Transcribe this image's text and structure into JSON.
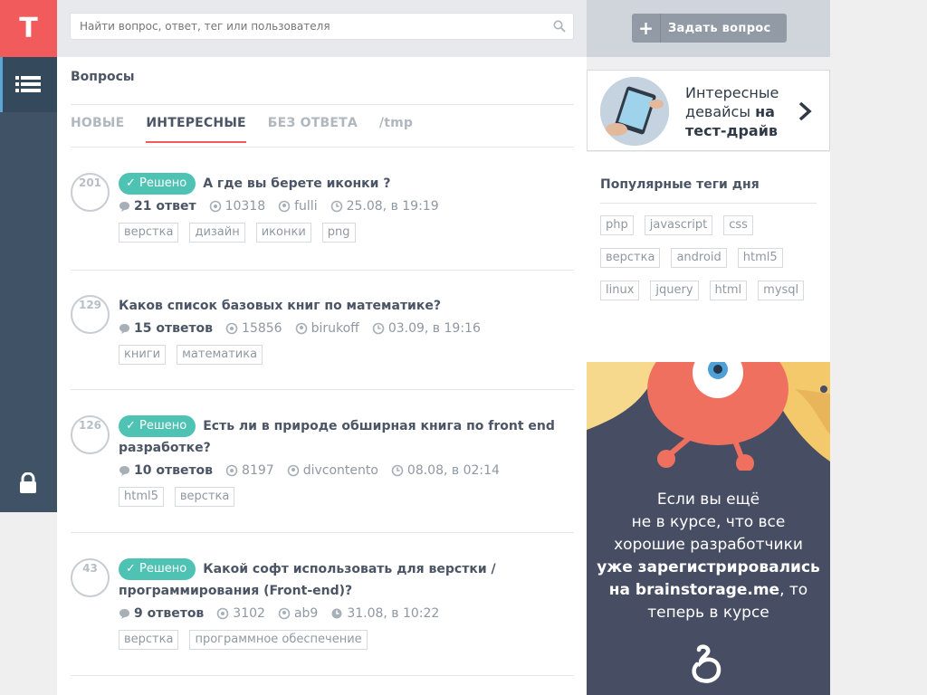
{
  "logo": {
    "letter": "T"
  },
  "search": {
    "placeholder": "Найти вопрос, ответ, тег или пользователя"
  },
  "ask_button": {
    "label": "Задать вопрос"
  },
  "page": {
    "title": "Вопросы"
  },
  "tabs": [
    {
      "label": "НОВЫЕ"
    },
    {
      "label": "ИНТЕРЕСНЫЕ"
    },
    {
      "label": "БЕЗ ОТВЕТА"
    },
    {
      "label": "/tmp"
    }
  ],
  "solved_label": "Решено",
  "questions": [
    {
      "count": "201",
      "solved": true,
      "title": "А где вы берете иконки ?",
      "answers": "21 ответ",
      "views": "10318",
      "author": "fulli",
      "date": "25.08, в 19:19",
      "tags": [
        "верстка",
        "дизайн",
        "иконки",
        "png"
      ]
    },
    {
      "count": "129",
      "solved": false,
      "title": "Каков список базовых книг по математике?",
      "answers": "15 ответов",
      "views": "15856",
      "author": "birukoff",
      "date": "03.09, в 19:16",
      "tags": [
        "книги",
        "математика"
      ]
    },
    {
      "count": "126",
      "solved": true,
      "title": "Есть ли в природе обширная книга по front end разработке?",
      "answers": "10 ответов",
      "views": "8197",
      "author": "divcontento",
      "date": "08.08, в 02:14",
      "tags": [
        "html5",
        "верстка"
      ]
    },
    {
      "count": "43",
      "solved": true,
      "title": "Какой софт использовать для верстки / программирования (Front-end)?",
      "answers": "9 ответов",
      "views": "3102",
      "author": "ab9",
      "date": "31.08, в 10:22",
      "tags": [
        "верстка",
        "программное обеспечение"
      ]
    }
  ],
  "promo": {
    "line1": "Интересные",
    "line2a": "девайсы ",
    "line2b": "на",
    "line3": "тест-драйв"
  },
  "popular_tags": {
    "title": "Популярные теги дня",
    "items": [
      "php",
      "javascript",
      "css",
      "верстка",
      "android",
      "html5",
      "linux",
      "jquery",
      "html",
      "mysql"
    ]
  },
  "ad": {
    "line1": "Если вы ещё",
    "line2": "не в курсе, что все",
    "line3": "хорошие разработчики",
    "line4": "уже зарегистрировались",
    "line5a": "на brainstorage.me",
    "line5b": ", то",
    "line6": "теперь в курсе"
  },
  "colors": {
    "accent": "#f15b5b",
    "solved": "#4fc3b3",
    "rail": "#3f5266",
    "ad_bg": "#474d63"
  }
}
